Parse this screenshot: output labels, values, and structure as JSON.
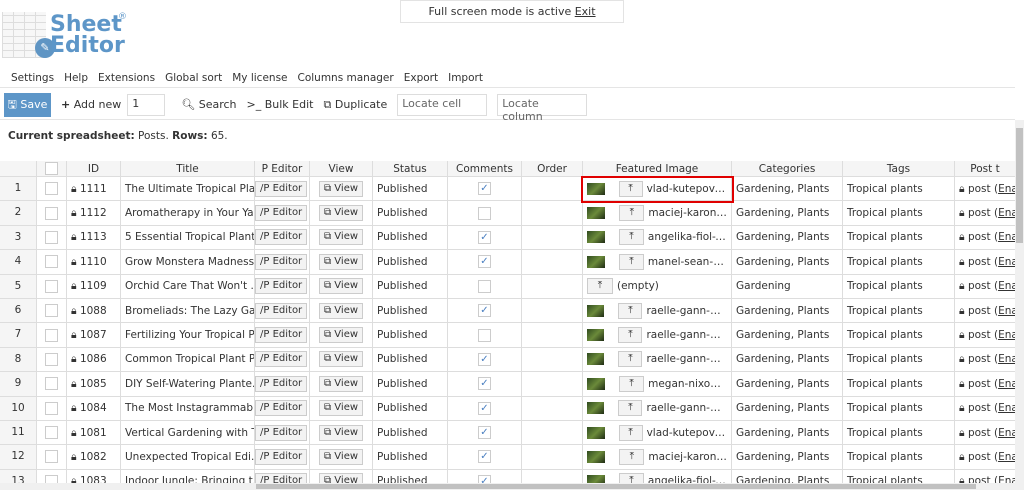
{
  "banner": {
    "text": "Full screen mode is active",
    "exit": "Exit"
  },
  "logo": {
    "line1": "Sheet",
    "line2": "Editor",
    "reg": "®"
  },
  "menu": [
    "Settings",
    "Help",
    "Extensions",
    "Global sort",
    "My license",
    "Columns manager",
    "Export",
    "Import"
  ],
  "toolbar": {
    "save": "Save",
    "add_new": "Add new",
    "add_count": "1",
    "search": "Search",
    "bulk_edit": "Bulk Edit",
    "duplicate": "Duplicate",
    "locate_cell": "Locate cell",
    "locate_column": "Locate column"
  },
  "info": {
    "label1": "Current spreadsheet:",
    "value1": "Posts.",
    "label2": "Rows:",
    "value2": "65."
  },
  "columns": [
    "ID",
    "Title",
    "P Editor",
    "View",
    "Status",
    "Comments",
    "Order",
    "Featured Image",
    "Categories",
    "Tags",
    "Post t"
  ],
  "wp_editor_label": "/P Editor",
  "view_label": "View",
  "post_type_prefix": "post (",
  "post_type_link": "Enal",
  "rows": [
    {
      "n": "1",
      "id": "1111",
      "title": "The Ultimate Tropical Pla...",
      "status": "Published",
      "comments": true,
      "image": "vlad-kutepov-s...",
      "cats": "Gardening, Plants",
      "tags": "Tropical plants"
    },
    {
      "n": "2",
      "id": "1112",
      "title": "Aromatherapy in Your Ya...",
      "status": "Published",
      "comments": false,
      "image": "maciej-karon-...",
      "cats": "Gardening, Plants",
      "tags": "Tropical plants"
    },
    {
      "n": "3",
      "id": "1113",
      "title": "5 Essential Tropical Plant...",
      "status": "Published",
      "comments": true,
      "image": "angelika-fiol-V...",
      "cats": "Gardening, Plants",
      "tags": "Tropical plants"
    },
    {
      "n": "4",
      "id": "1110",
      "title": "Grow Monstera Madness...",
      "status": "Published",
      "comments": true,
      "image": "manel-sean-O...",
      "cats": "Gardening, Plants",
      "tags": "Tropical plants"
    },
    {
      "n": "5",
      "id": "1109",
      "title": "Orchid Care That Won't ...",
      "status": "Published",
      "comments": false,
      "image": "(empty)",
      "cats": "Gardening",
      "tags": "Tropical plants"
    },
    {
      "n": "6",
      "id": "1088",
      "title": "Bromeliads: The Lazy Gar...",
      "status": "Published",
      "comments": true,
      "image": "raelle-gann-ow...",
      "cats": "Gardening, Plants",
      "tags": "Tropical plants"
    },
    {
      "n": "7",
      "id": "1087",
      "title": "Fertilizing Your Tropical P...",
      "status": "Published",
      "comments": false,
      "image": "raelle-gann-ow...",
      "cats": "Gardening, Plants",
      "tags": "Tropical plants"
    },
    {
      "n": "8",
      "id": "1086",
      "title": "Common Tropical Plant P...",
      "status": "Published",
      "comments": true,
      "image": "raelle-gann-ow...",
      "cats": "Gardening, Plants",
      "tags": "Tropical plants"
    },
    {
      "n": "9",
      "id": "1085",
      "title": "DIY Self-Watering Plante...",
      "status": "Published",
      "comments": true,
      "image": "megan-nixon-...",
      "cats": "Gardening, Plants",
      "tags": "Tropical plants"
    },
    {
      "n": "10",
      "id": "1084",
      "title": "The Most Instagrammabl...",
      "status": "Published",
      "comments": true,
      "image": "raelle-gann-ow...",
      "cats": "Gardening, Plants",
      "tags": "Tropical plants"
    },
    {
      "n": "11",
      "id": "1081",
      "title": "Vertical Gardening with T...",
      "status": "Published",
      "comments": true,
      "image": "vlad-kutepov-s...",
      "cats": "Gardening, Plants",
      "tags": "Tropical plants"
    },
    {
      "n": "12",
      "id": "1082",
      "title": "Unexpected Tropical Edi...",
      "status": "Published",
      "comments": true,
      "image": "maciej-karon-...",
      "cats": "Gardening, Plants",
      "tags": "Tropical plants"
    },
    {
      "n": "13",
      "id": "1083",
      "title": "Indoor Jungle: Bringing t...",
      "status": "Published",
      "comments": true,
      "image": "angelika-fiol-V...",
      "cats": "Gardening, Plants",
      "tags": "Tropical plants"
    }
  ],
  "colors": {
    "accent": "#5d96c8",
    "highlight": "#e00000"
  }
}
